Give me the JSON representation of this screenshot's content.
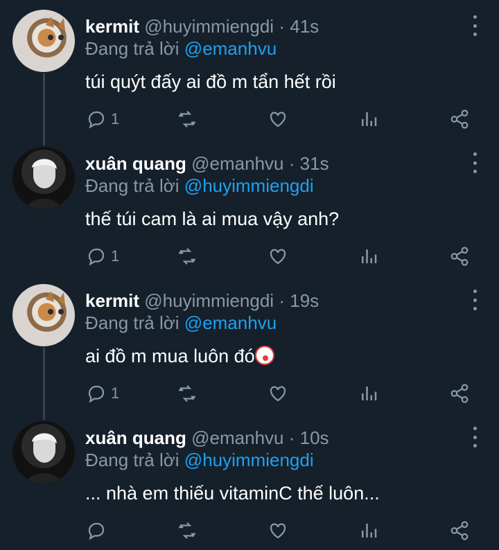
{
  "tweets": [
    {
      "name": "kermit",
      "handle": "@huyimmiengdi",
      "sep": "·",
      "time": "41s",
      "reply_prefix": "Đang trả lời",
      "reply_to": "@emanhvu",
      "text": "túi quýt đấy ai đồ m tẩn hết rồi",
      "reply_count": "1",
      "avatar": "cat"
    },
    {
      "name": "xuân quang",
      "handle": "@emanhvu",
      "sep": "·",
      "time": "31s",
      "reply_prefix": "Đang trả lời",
      "reply_to": "@huyimmiengdi",
      "text": "thế túi cam là ai mua vậy anh?",
      "reply_count": "1",
      "avatar": "man"
    },
    {
      "name": "kermit",
      "handle": "@huyimmiengdi",
      "sep": "·",
      "time": "19s",
      "reply_prefix": "Đang trả lời",
      "reply_to": "@emanhvu",
      "text": "ai đồ m mua luôn đó",
      "emoji": "clown-face-emoji",
      "reply_count": "1",
      "avatar": "cat"
    },
    {
      "name": "xuân quang",
      "handle": "@emanhvu",
      "sep": "·",
      "time": "10s",
      "reply_prefix": "Đang trả lời",
      "reply_to": "@huyimmiengdi",
      "text": "... nhà em thiếu vitaminC thế luôn...",
      "reply_count": "",
      "avatar": "man"
    }
  ],
  "icons": {
    "reply": "reply-icon",
    "retweet": "retweet-icon",
    "like": "heart-icon",
    "analytics": "analytics-icon",
    "share": "share-icon",
    "more": "more-vertical-icon"
  },
  "colors": {
    "background": "#15202b",
    "secondary_text": "#8899a6",
    "mention": "#1da1f2",
    "thread_line": "#38444d"
  }
}
